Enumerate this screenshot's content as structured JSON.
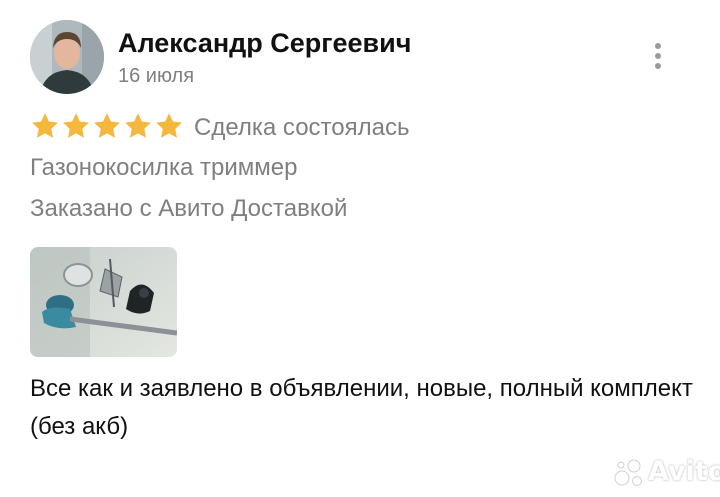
{
  "review": {
    "author_name": "Александр Сергеевич",
    "date": "16 июля",
    "rating": 5,
    "rating_max": 5,
    "deal_status": "Сделка состоялась",
    "product": "Газонокосилка триммер",
    "delivery_note": "Заказано с Авито Доставкой",
    "text": "Все как и заявлено в объявлении, новые, полный комплект (без акб)"
  },
  "icons": {
    "more": "more-vertical-icon",
    "star": "star-icon"
  },
  "colors": {
    "star": "#F5B73C",
    "muted_text": "#7F7F7F",
    "primary_text": "#111111"
  },
  "watermark": {
    "brand": "Avito"
  }
}
